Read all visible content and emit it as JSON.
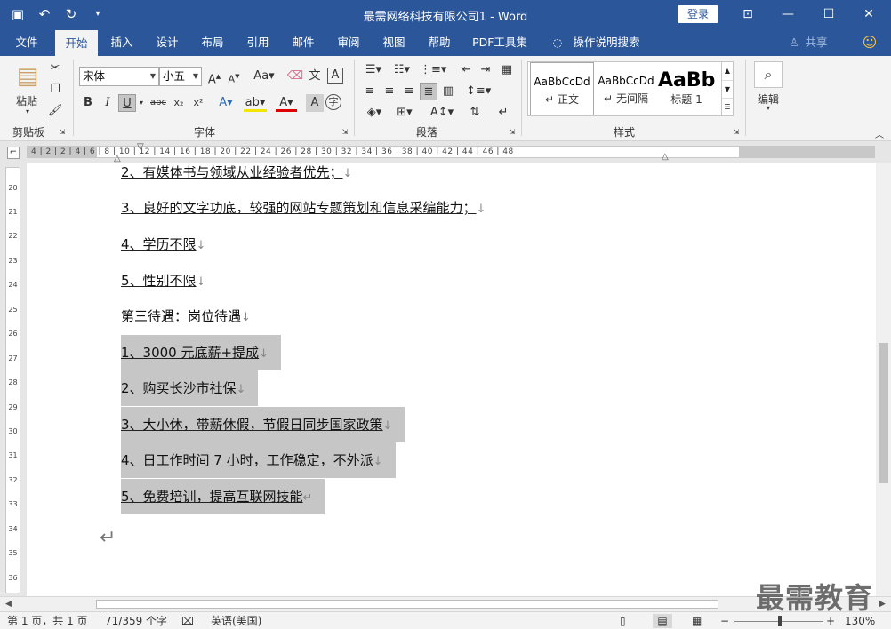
{
  "window": {
    "title": "最需网络科技有限公司1  -  Word",
    "login_label": "登录",
    "share_label": "共享"
  },
  "tabs": [
    "文件",
    "开始",
    "插入",
    "设计",
    "布局",
    "引用",
    "邮件",
    "审阅",
    "视图",
    "帮助",
    "PDF工具集",
    "操作说明搜索"
  ],
  "ribbon": {
    "clipboard": {
      "paste_label": "粘贴",
      "group_label": "剪贴板"
    },
    "font": {
      "font_name": "宋体",
      "font_size": "小五",
      "group_label": "字体"
    },
    "paragraph": {
      "group_label": "段落"
    },
    "styles": {
      "group_label": "样式",
      "items": [
        {
          "sample": "AaBbCcDd",
          "name": "正文"
        },
        {
          "sample": "AaBbCcDd",
          "name": "无间隔"
        },
        {
          "sample": "AaBb",
          "name": "标题 1"
        }
      ]
    },
    "editing": {
      "label": "编辑"
    }
  },
  "ruler": {
    "marks": "4 | 2 | 2 | 4 | 6 | 8 | 10 | 12 | 14 | 16 | 18 | 20 | 22 | 24 | 26 | 28 | 30 | 32 | 34 | 36 | 38 | 40 | 42 | 44 | 46 | 48",
    "vertical": [
      "20",
      "21",
      "22",
      "23",
      "24",
      "25",
      "26",
      "27",
      "28",
      "29",
      "30",
      "31",
      "32",
      "33",
      "34",
      "35",
      "36"
    ]
  },
  "document": {
    "lines": [
      "2、有媒体书与领域从业经验者优先；",
      "3、良好的文字功底，较强的网站专题策划和信息采编能力；",
      "4、学历不限",
      "5、性别不限",
      "第三待遇：岗位待遇",
      "1、3000 元底薪+提成",
      "2、购买长沙市社保",
      "3、大小休，带薪休假，节假日同步国家政策",
      "4、日工作时间 7 小时，工作稳定，不外派",
      "5、免费培训，提高互联网技能"
    ]
  },
  "status": {
    "page": "第 1 页，共 1 页",
    "words": "71/359 个字",
    "language": "英语(美国)",
    "zoom": "130%"
  },
  "watermark": "最需教育"
}
